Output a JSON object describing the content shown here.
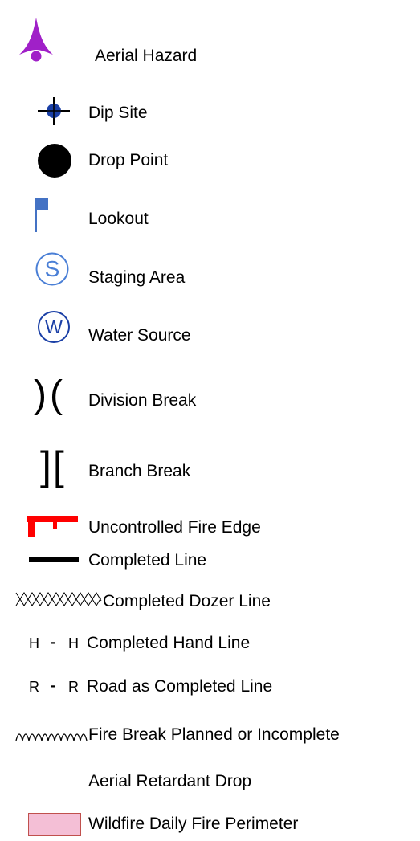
{
  "legend": {
    "items": [
      {
        "label": "Aerial Hazard",
        "icon": "aerial-hazard-icon",
        "color": "#a020c8"
      },
      {
        "label": "Dip Site",
        "icon": "dip-site-crosshair-icon",
        "color": "#1a3fa6"
      },
      {
        "label": "Drop Point",
        "icon": "drop-point-icon",
        "color": "#000000"
      },
      {
        "label": "Lookout",
        "icon": "lookout-flag-icon",
        "color": "#4472c4"
      },
      {
        "label": "Staging Area",
        "icon": "staging-area-icon",
        "symbol_text": "S",
        "color": "#4a7fd6"
      },
      {
        "label": "Water Source",
        "icon": "water-source-icon",
        "symbol_text": "W",
        "color": "#1a3fa6"
      },
      {
        "label": "Division Break",
        "icon": "division-break-icon",
        "symbol_text": ")(",
        "color": "#000000"
      },
      {
        "label": "Branch Break",
        "icon": "branch-break-icon",
        "symbol_text": "][",
        "color": "#000000"
      },
      {
        "label": "Uncontrolled Fire Edge",
        "icon": "uncontrolled-fire-edge-icon",
        "color": "#ff0000"
      },
      {
        "label": "Completed Line",
        "icon": "completed-line-icon",
        "color": "#000000"
      },
      {
        "label": "Completed Dozer Line",
        "icon": "dozer-line-icon",
        "color": "#000000"
      },
      {
        "label": "Completed Hand Line",
        "icon": "hand-line-icon",
        "symbol_text": "H",
        "color": "#000000"
      },
      {
        "label": "Road as Completed Line",
        "icon": "road-line-icon",
        "symbol_text": "R",
        "color": "#000000"
      },
      {
        "label": "Fire Break Planned or Incomplete",
        "icon": "fire-break-planned-icon",
        "color": "#000000"
      },
      {
        "label": "Aerial Retardant Drop",
        "icon": "aerial-retardant-drop-icon",
        "color": "#ffffff"
      },
      {
        "label": "Wildfire Daily Fire Perimeter",
        "icon": "fire-perimeter-swatch-icon",
        "color": "#f4bfd6"
      }
    ]
  }
}
